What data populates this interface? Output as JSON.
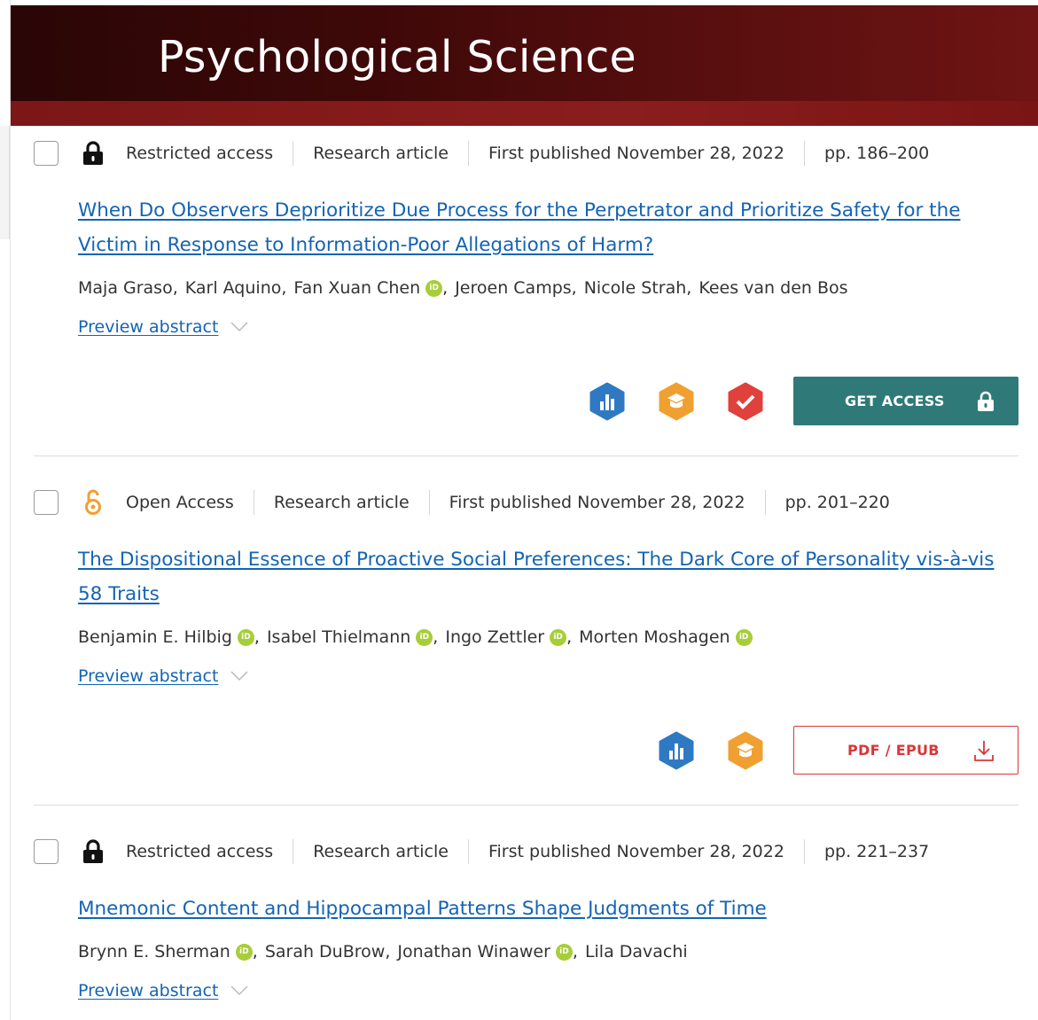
{
  "journal": {
    "title": "Psychological Science"
  },
  "articles": [
    {
      "access": "Restricted access",
      "access_icon": "lock-icon",
      "type": "Research article",
      "published": "First published November 28, 2022",
      "pages": "pp. 186–200",
      "title": "When Do Observers Deprioritize Due Process for the Perpetrator and Prioritize Safety for the Victim in Response to Information-Poor Allegations of Harm?",
      "authors": [
        "Maja Graso",
        "Karl Aquino",
        "Fan Xuan Chen",
        "Jeroen Camps",
        "Nicole Strah",
        "Kees van den Bos"
      ],
      "preview": "Preview abstract",
      "action_label": "GET ACCESS"
    },
    {
      "access": "Open Access",
      "access_icon": "open-access-icon",
      "type": "Research article",
      "published": "First published November 28, 2022",
      "pages": "pp. 201–220",
      "title": "The Dispositional Essence of Proactive Social Preferences: The Dark Core of Personality vis-à-vis 58 Traits",
      "authors": [
        "Benjamin E. Hilbig",
        "Isabel Thielmann",
        "Ingo Zettler",
        "Morten Moshagen"
      ],
      "preview": "Preview abstract",
      "action_label": "PDF / EPUB"
    },
    {
      "access": "Restricted access",
      "access_icon": "lock-icon",
      "type": "Research article",
      "published": "First published November 28, 2022",
      "pages": "pp. 221–237",
      "title": "Mnemonic Content and Hippocampal Patterns Shape Judgments of Time",
      "authors": [
        "Brynn E. Sherman",
        "Sarah DuBrow",
        "Jonathan Winawer",
        "Lila Davachi"
      ],
      "preview": "Preview abstract"
    }
  ],
  "colors": {
    "link": "#1464b4",
    "access_button": "#2f7a78",
    "pdf_button": "#d8373a",
    "orcid": "#a6ce39",
    "header": "#5a0f0f"
  }
}
